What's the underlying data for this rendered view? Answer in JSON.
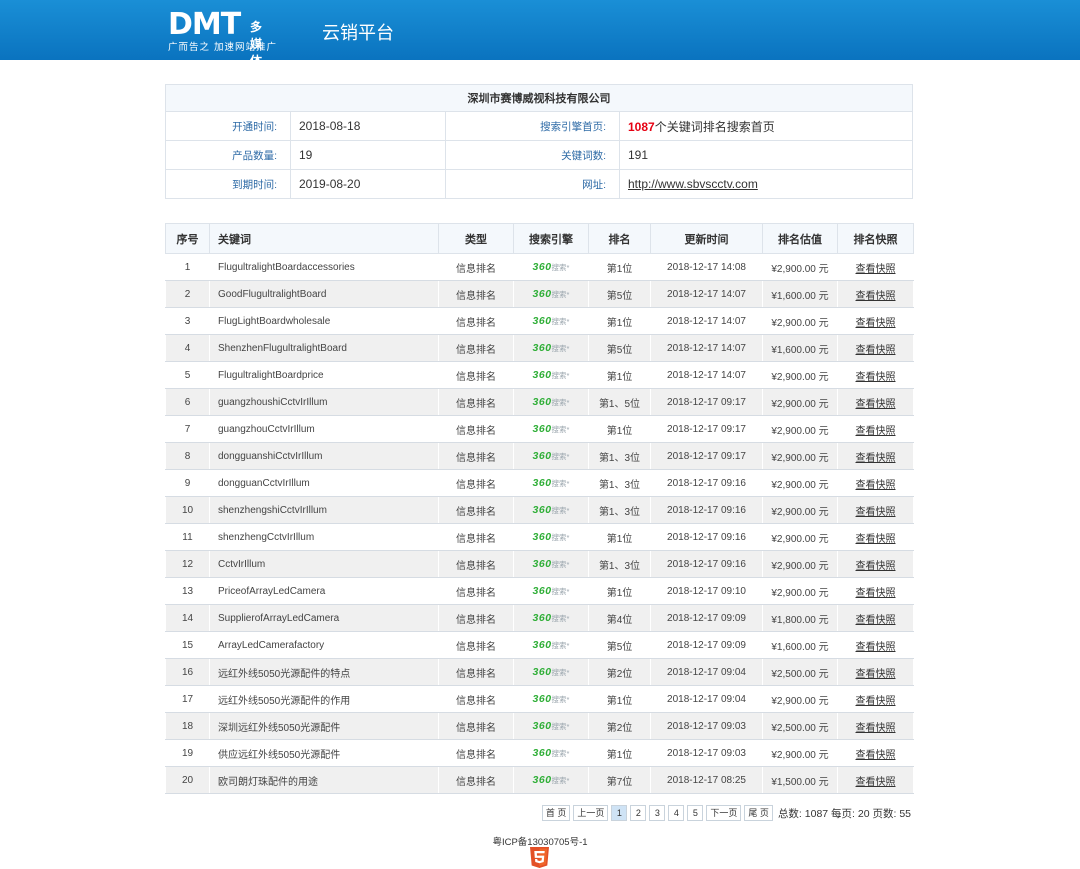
{
  "header": {
    "logo_main": "DMT",
    "logo_small": "多媒体",
    "logo_slogan": "广而告之  加速网站推广",
    "platform": "云销平台"
  },
  "info": {
    "company": "深圳市赛博威视科技有限公司",
    "open_label": "开通时间:",
    "open_value": "2018-08-18",
    "engine_label": "搜索引擎首页:",
    "engine_count": "1087",
    "engine_text": "个关键词排名搜索首页",
    "product_label": "产品数量:",
    "product_value": "19",
    "keyword_label": "关键词数:",
    "keyword_value": "191",
    "expire_label": "到期时间:",
    "expire_value": "2019-08-20",
    "site_label": "网址:",
    "site_value": "http://www.sbvscctv.com"
  },
  "table": {
    "headers": [
      "序号",
      "关键词",
      "类型",
      "搜索引擎",
      "排名",
      "更新时间",
      "排名估值",
      "排名快照"
    ],
    "engine_logo": "360",
    "engine_suffix": "搜索*",
    "rows": [
      {
        "no": "1",
        "kw": "FlugultralightBoardaccessories",
        "type": "信息排名",
        "rank": "第1位",
        "time": "2018-12-17 14:08",
        "price": "¥2,900.00 元",
        "snap": "查看快照"
      },
      {
        "no": "2",
        "kw": "GoodFlugultralightBoard",
        "type": "信息排名",
        "rank": "第5位",
        "time": "2018-12-17 14:07",
        "price": "¥1,600.00 元",
        "snap": "查看快照"
      },
      {
        "no": "3",
        "kw": "FlugLightBoardwholesale",
        "type": "信息排名",
        "rank": "第1位",
        "time": "2018-12-17 14:07",
        "price": "¥2,900.00 元",
        "snap": "查看快照"
      },
      {
        "no": "4",
        "kw": "ShenzhenFlugultralightBoard",
        "type": "信息排名",
        "rank": "第5位",
        "time": "2018-12-17 14:07",
        "price": "¥1,600.00 元",
        "snap": "查看快照"
      },
      {
        "no": "5",
        "kw": "FlugultralightBoardprice",
        "type": "信息排名",
        "rank": "第1位",
        "time": "2018-12-17 14:07",
        "price": "¥2,900.00 元",
        "snap": "查看快照"
      },
      {
        "no": "6",
        "kw": "guangzhoushiCctvIrIllum",
        "type": "信息排名",
        "rank": "第1、5位",
        "time": "2018-12-17 09:17",
        "price": "¥2,900.00 元",
        "snap": "查看快照"
      },
      {
        "no": "7",
        "kw": "guangzhouCctvIrIllum",
        "type": "信息排名",
        "rank": "第1位",
        "time": "2018-12-17 09:17",
        "price": "¥2,900.00 元",
        "snap": "查看快照"
      },
      {
        "no": "8",
        "kw": "dongguanshiCctvIrIllum",
        "type": "信息排名",
        "rank": "第1、3位",
        "time": "2018-12-17 09:17",
        "price": "¥2,900.00 元",
        "snap": "查看快照"
      },
      {
        "no": "9",
        "kw": "dongguanCctvIrIllum",
        "type": "信息排名",
        "rank": "第1、3位",
        "time": "2018-12-17 09:16",
        "price": "¥2,900.00 元",
        "snap": "查看快照"
      },
      {
        "no": "10",
        "kw": "shenzhengshiCctvIrIllum",
        "type": "信息排名",
        "rank": "第1、3位",
        "time": "2018-12-17 09:16",
        "price": "¥2,900.00 元",
        "snap": "查看快照"
      },
      {
        "no": "11",
        "kw": "shenzhengCctvIrIllum",
        "type": "信息排名",
        "rank": "第1位",
        "time": "2018-12-17 09:16",
        "price": "¥2,900.00 元",
        "snap": "查看快照"
      },
      {
        "no": "12",
        "kw": "CctvIrIllum",
        "type": "信息排名",
        "rank": "第1、3位",
        "time": "2018-12-17 09:16",
        "price": "¥2,900.00 元",
        "snap": "查看快照"
      },
      {
        "no": "13",
        "kw": "PriceofArrayLedCamera",
        "type": "信息排名",
        "rank": "第1位",
        "time": "2018-12-17 09:10",
        "price": "¥2,900.00 元",
        "snap": "查看快照"
      },
      {
        "no": "14",
        "kw": "SupplierofArrayLedCamera",
        "type": "信息排名",
        "rank": "第4位",
        "time": "2018-12-17 09:09",
        "price": "¥1,800.00 元",
        "snap": "查看快照"
      },
      {
        "no": "15",
        "kw": "ArrayLedCamerafactory",
        "type": "信息排名",
        "rank": "第5位",
        "time": "2018-12-17 09:09",
        "price": "¥1,600.00 元",
        "snap": "查看快照"
      },
      {
        "no": "16",
        "kw": "远红外线5050光源配件的特点",
        "type": "信息排名",
        "rank": "第2位",
        "time": "2018-12-17 09:04",
        "price": "¥2,500.00 元",
        "snap": "查看快照"
      },
      {
        "no": "17",
        "kw": "远红外线5050光源配件的作用",
        "type": "信息排名",
        "rank": "第1位",
        "time": "2018-12-17 09:04",
        "price": "¥2,900.00 元",
        "snap": "查看快照"
      },
      {
        "no": "18",
        "kw": "深圳远红外线5050光源配件",
        "type": "信息排名",
        "rank": "第2位",
        "time": "2018-12-17 09:03",
        "price": "¥2,500.00 元",
        "snap": "查看快照"
      },
      {
        "no": "19",
        "kw": "供应远红外线5050光源配件",
        "type": "信息排名",
        "rank": "第1位",
        "time": "2018-12-17 09:03",
        "price": "¥2,900.00 元",
        "snap": "查看快照"
      },
      {
        "no": "20",
        "kw": "欧司朗灯珠配件的用途",
        "type": "信息排名",
        "rank": "第7位",
        "time": "2018-12-17 08:25",
        "price": "¥1,500.00 元",
        "snap": "查看快照"
      }
    ]
  },
  "pager": {
    "first": "首 页",
    "prev": "上一页",
    "pages": [
      "1",
      "2",
      "3",
      "4",
      "5"
    ],
    "current": "1",
    "next": "下一页",
    "last": "尾 页",
    "stats": "总数: 1087 每页: 20 页数: 55"
  },
  "footer": {
    "icp": "粤ICP备13030705号-1",
    "html5_icon": "html5-icon"
  },
  "colors": {
    "header_top": "#1a8fd6",
    "header_bottom": "#0a73bf",
    "accent_red": "#e60012",
    "engine_green": "#2eae36",
    "label_blue": "#2d6aa6"
  }
}
